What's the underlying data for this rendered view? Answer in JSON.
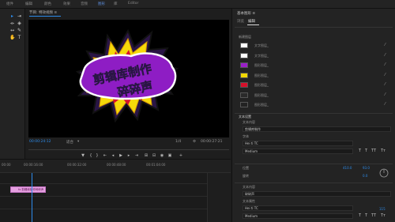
{
  "menu": {
    "items": [
      "组件",
      "编辑",
      "颜色",
      "效果",
      "音频",
      "图形",
      "库",
      "Editor"
    ],
    "active_index": 5
  },
  "tools": [
    "selection-tool",
    "track-select-tool",
    "ripple-edit-tool",
    "razor-tool",
    "slip-tool",
    "pen-tool",
    "hand-tool",
    "type-tool"
  ],
  "monitor": {
    "title": "节目: 特效视频 ≡",
    "graphic": {
      "line1": "剪辑库制作",
      "line2": "碎碎声"
    },
    "timecode_current": "00:00:24:12",
    "fit_label": "适合",
    "resolution": "1/4",
    "timecode_duration": "00:00:27:21",
    "controls": [
      "marker",
      "in-point",
      "out-point",
      "go-to-in",
      "step-back",
      "play",
      "step-forward",
      "go-to-out",
      "insert",
      "overwrite",
      "export-frame",
      "compare",
      "settings"
    ]
  },
  "panel": {
    "title": "基本图形 ≡",
    "tabs": [
      "浏览",
      "编辑"
    ],
    "active_tab": 1,
    "section_layers": "新建图层",
    "layers": [
      {
        "name": "文字图层_",
        "color": "#ffffff"
      },
      {
        "name": "文字图层_",
        "color": "#ffffff"
      },
      {
        "name": "图形图层_",
        "color": "#9b1fc9"
      },
      {
        "name": "图形图层_",
        "color": "#f2d800"
      },
      {
        "name": "图形图层_",
        "color": "#d60f2a"
      },
      {
        "name": "图形图层_",
        "color": "#2a2a2a"
      },
      {
        "name": "图形图层_",
        "color": "#222222"
      }
    ],
    "text_section": "文本设置",
    "text_label": "文本内容",
    "text_value": "剪辑库制作",
    "font_label": "字体",
    "font_value": "Hei ti TC",
    "style_value": "Medium",
    "format_buttons": [
      "T",
      "T",
      "TT",
      "Tт"
    ],
    "position_label": "位置",
    "position_x": "410.0",
    "position_y": "93.0",
    "rotation_label": "旋转",
    "rotation_value": "0.0",
    "text2_label": "文本内容",
    "text2_value": "碎碎声",
    "font2_label": "文本属性",
    "font2_value": "Hei ti TC",
    "style2_value": "Medium",
    "size2_value": "115"
  },
  "timeline": {
    "times": [
      "00:00",
      "00:00:16:00",
      "00:00:32:00",
      "00:00:48:00",
      "00:01:04:00"
    ],
    "clip_label": "fx 剪辑库制作碎碎声"
  }
}
